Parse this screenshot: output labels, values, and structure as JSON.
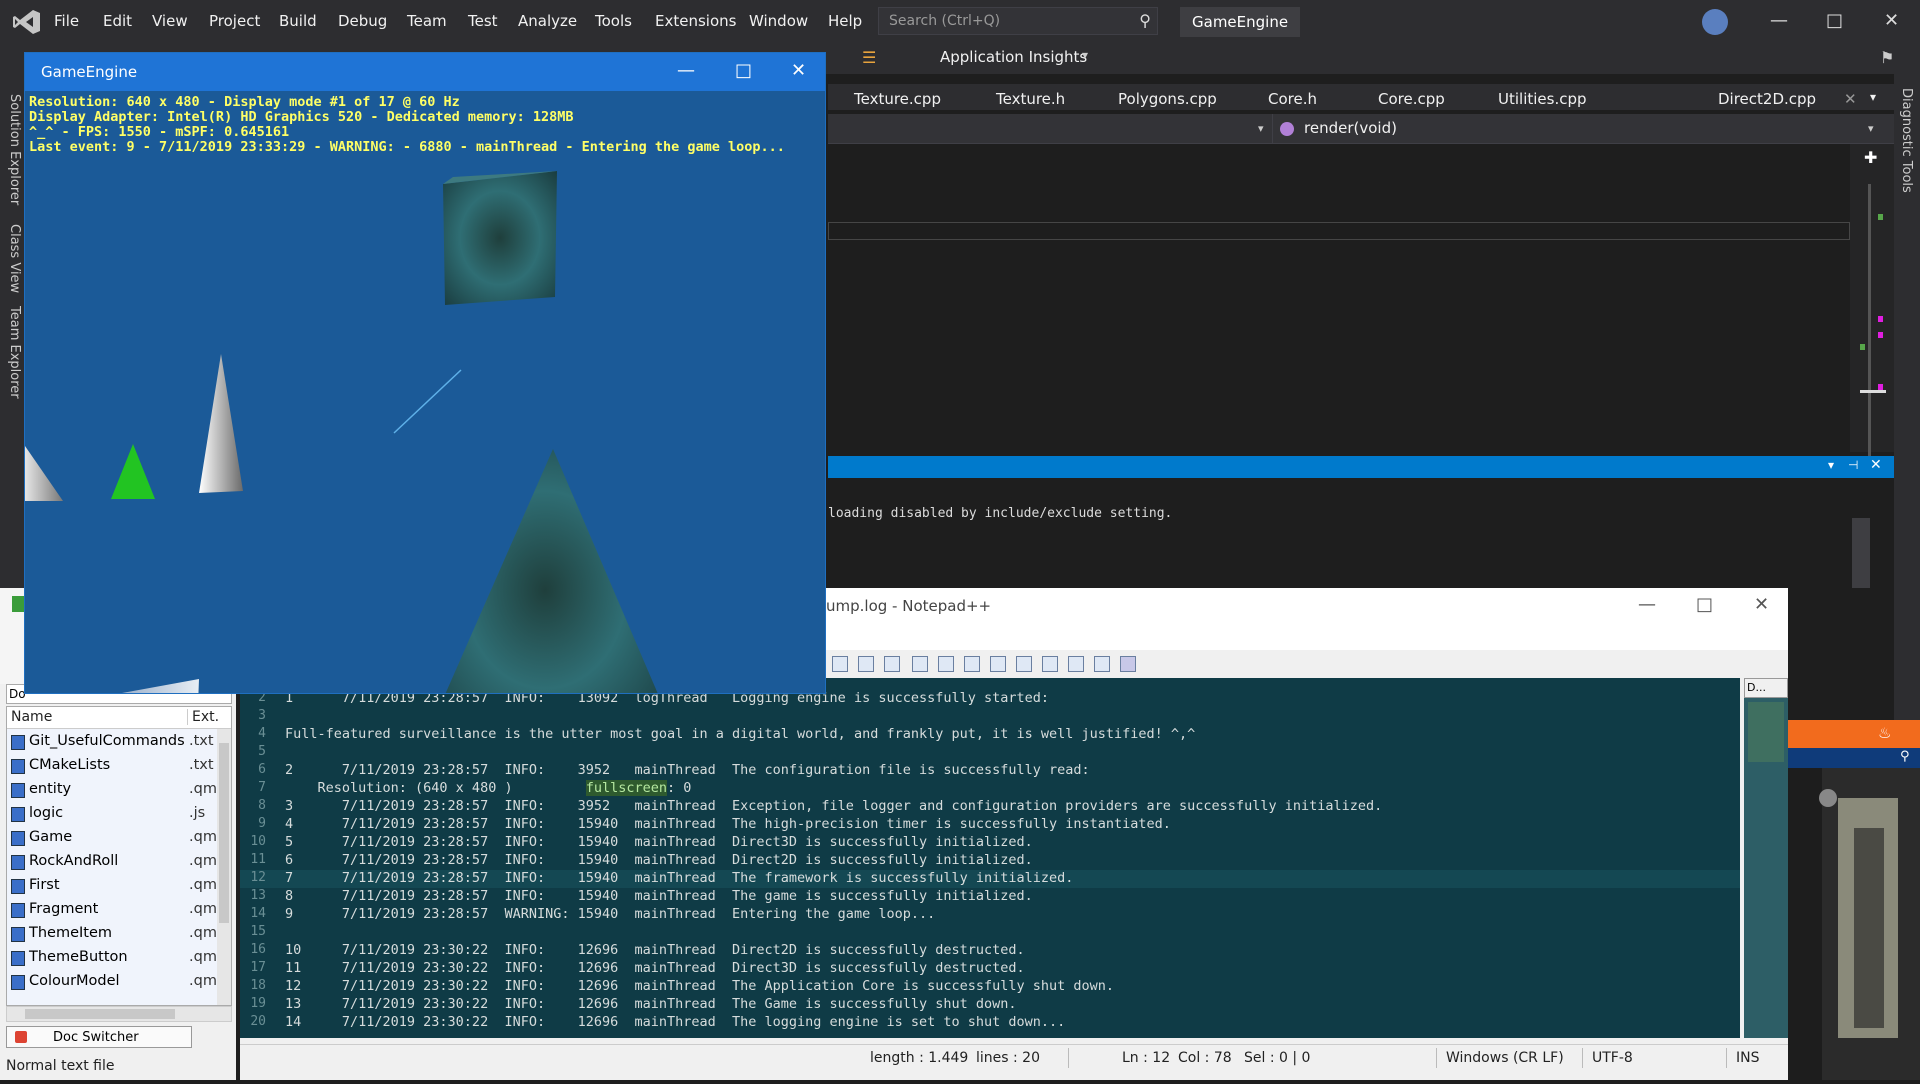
{
  "vs": {
    "menu": [
      "File",
      "Edit",
      "View",
      "Project",
      "Build",
      "Debug",
      "Team",
      "Test",
      "Analyze",
      "Tools",
      "Extensions",
      "Window",
      "Help"
    ],
    "search_placeholder": "Search (Ctrl+Q)",
    "title": "GameEngine",
    "app_insights": "Application Insights",
    "left_rail": [
      "Solution Explorer",
      "Class View",
      "Team Explorer"
    ],
    "right_rail": "Diagnostic Tools",
    "tabs": [
      "Texture.cpp",
      "Texture.h",
      "Polygons.cpp",
      "Core.h",
      "Core.cpp",
      "Utilities.cpp",
      "Direct2D.cpp"
    ],
    "nav_function": "render(void)",
    "output_text": "loading disabled by include/exclude setting."
  },
  "gameengine": {
    "title": "GameEngine",
    "hud": [
      "Resolution: 640 x 480 - Display mode #1 of 17 @ 60 Hz",
      "Display Adapter: Intel(R) HD Graphics 520 - Dedicated memory: 128MB",
      "^_^ - FPS: 1550 - mSPF: 0.645161",
      "Last event: 9 - 7/11/2019 23:33:29 - WARNING: - 6880 - mainThread - Entering the game loop..."
    ]
  },
  "npp": {
    "title": "ump.log - Notepad++",
    "close_x": "X",
    "docmap_label": "D...",
    "lines": [
      {
        "n": "2",
        "t": "1      7/11/2019 23:28:57  INFO:    13092  logThread   Logging engine is successfully started:"
      },
      {
        "n": "3",
        "t": ""
      },
      {
        "n": "4",
        "t": "Full-featured surveillance is the utter most goal in a digital world, and frankly put, it is well justified! ^,^"
      },
      {
        "n": "5",
        "t": ""
      },
      {
        "n": "6",
        "t": "2      7/11/2019 23:28:57  INFO:    3952   mainThread  The configuration file is successfully read:"
      },
      {
        "n": "7",
        "t": "    Resolution: (640 x 480 )         ",
        "hl": "fullscreen",
        "rest": ": 0"
      },
      {
        "n": "8",
        "t": "3      7/11/2019 23:28:57  INFO:    3952   mainThread  Exception, file logger and configuration providers are successfully initialized."
      },
      {
        "n": "9",
        "t": "4      7/11/2019 23:28:57  INFO:    15940  mainThread  The high-precision timer is successfully instantiated."
      },
      {
        "n": "10",
        "t": "5      7/11/2019 23:28:57  INFO:    15940  mainThread  Direct3D is successfully initialized."
      },
      {
        "n": "11",
        "t": "6      7/11/2019 23:28:57  INFO:    15940  mainThread  Direct2D is successfully initialized."
      },
      {
        "n": "12",
        "t": "7      7/11/2019 23:28:57  INFO:    15940  mainThread  The framework is successfully initialized."
      },
      {
        "n": "13",
        "t": "8      7/11/2019 23:28:57  INFO:    15940  mainThread  The game is successfully initialized."
      },
      {
        "n": "14",
        "t": "9      7/11/2019 23:28:57  WARNING: 15940  mainThread  Entering the game loop..."
      },
      {
        "n": "15",
        "t": ""
      },
      {
        "n": "16",
        "t": "10     7/11/2019 23:30:22  INFO:    12696  mainThread  Direct2D is successfully destructed."
      },
      {
        "n": "17",
        "t": "11     7/11/2019 23:30:22  INFO:    12696  mainThread  Direct3D is successfully destructed."
      },
      {
        "n": "18",
        "t": "12     7/11/2019 23:30:22  INFO:    12696  mainThread  The Application Core is successfully shut down."
      },
      {
        "n": "19",
        "t": "13     7/11/2019 23:30:22  INFO:    12696  mainThread  The Game is successfully shut down."
      },
      {
        "n": "20",
        "t": "14     7/11/2019 23:30:22  INFO:    12696  mainThread  The logging engine is set to shut down..."
      }
    ],
    "status": {
      "length": "length : 1.449",
      "lines": "lines : 20",
      "ln": "Ln : 12",
      "col": "Col : 78",
      "sel": "Sel : 0 | 0",
      "eol": "Windows (CR LF)",
      "enc": "UTF-8",
      "mode": "INS"
    }
  },
  "doc_switcher": {
    "col_name": "Name",
    "col_ext": "Ext.",
    "files": [
      {
        "name": "Git_UsefulCommands",
        "ext": ".txt"
      },
      {
        "name": "CMakeLists",
        "ext": ".txt"
      },
      {
        "name": "entity",
        "ext": ".qm"
      },
      {
        "name": "logic",
        "ext": ".js"
      },
      {
        "name": "Game",
        "ext": ".qm"
      },
      {
        "name": "RockAndRoll",
        "ext": ".qm"
      },
      {
        "name": "First",
        "ext": ".qm"
      },
      {
        "name": "Fragment",
        "ext": ".qm"
      },
      {
        "name": "ThemeItem",
        "ext": ".qm"
      },
      {
        "name": "ThemeButton",
        "ext": ".qm"
      },
      {
        "name": "ColourModel",
        "ext": ".qm"
      }
    ],
    "switcher_label": "Doc Switcher",
    "status": "Normal text file"
  }
}
